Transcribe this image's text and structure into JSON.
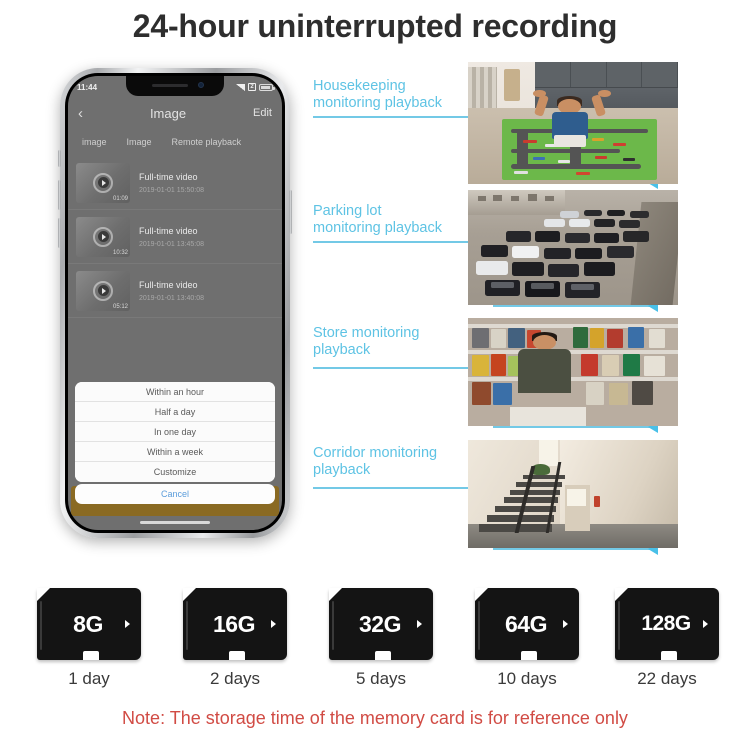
{
  "page": {
    "title": "24-hour uninterrupted recording",
    "note": "Note: The storage time of the memory card is for reference only",
    "accent_blue": "#5ec3e4",
    "note_color": "#d14b44"
  },
  "phone": {
    "statusbar": {
      "time": "11:44",
      "signal_icon": "signal-icon",
      "wifi_icon": "wifi-icon",
      "battery_icon": "battery-icon"
    },
    "navbar": {
      "back_icon": "chevron-left-icon",
      "title": "Image",
      "edit_label": "Edit"
    },
    "tabs": [
      {
        "label": "image"
      },
      {
        "label": "Image"
      },
      {
        "label": "Remote playback"
      }
    ],
    "videos": [
      {
        "title": "Full-time video",
        "timestamp": "2019-01-01 15:50:08",
        "duration": "01:09"
      },
      {
        "title": "Full-time video",
        "timestamp": "2019-01-01 13:45:08",
        "duration": "10:32"
      },
      {
        "title": "Full-time video",
        "timestamp": "2019-01-01 13:40:08",
        "duration": "05:12"
      }
    ],
    "action_sheet": {
      "options": [
        {
          "label": "Within an hour"
        },
        {
          "label": "Half a day"
        },
        {
          "label": "In one day"
        },
        {
          "label": "Within a week"
        },
        {
          "label": "Customize"
        }
      ],
      "cancel_label": "Cancel"
    }
  },
  "callouts": [
    {
      "label": "Housekeeping\nmonitoring playback",
      "scene": "child-play-mat-living-room"
    },
    {
      "label": "Parking lot\nmonitoring playback",
      "scene": "parking-lot-cars"
    },
    {
      "label": "Store monitoring\nplayback",
      "scene": "store-owner-counter"
    },
    {
      "label": "Corridor monitoring\nplayback",
      "scene": "corridor-staircase"
    }
  ],
  "memory_cards": [
    {
      "capacity": "8G",
      "days": "1 day"
    },
    {
      "capacity": "16G",
      "days": "2 days"
    },
    {
      "capacity": "32G",
      "days": "5 days"
    },
    {
      "capacity": "64G",
      "days": "10 days"
    },
    {
      "capacity": "128G",
      "days": "22 days"
    }
  ]
}
